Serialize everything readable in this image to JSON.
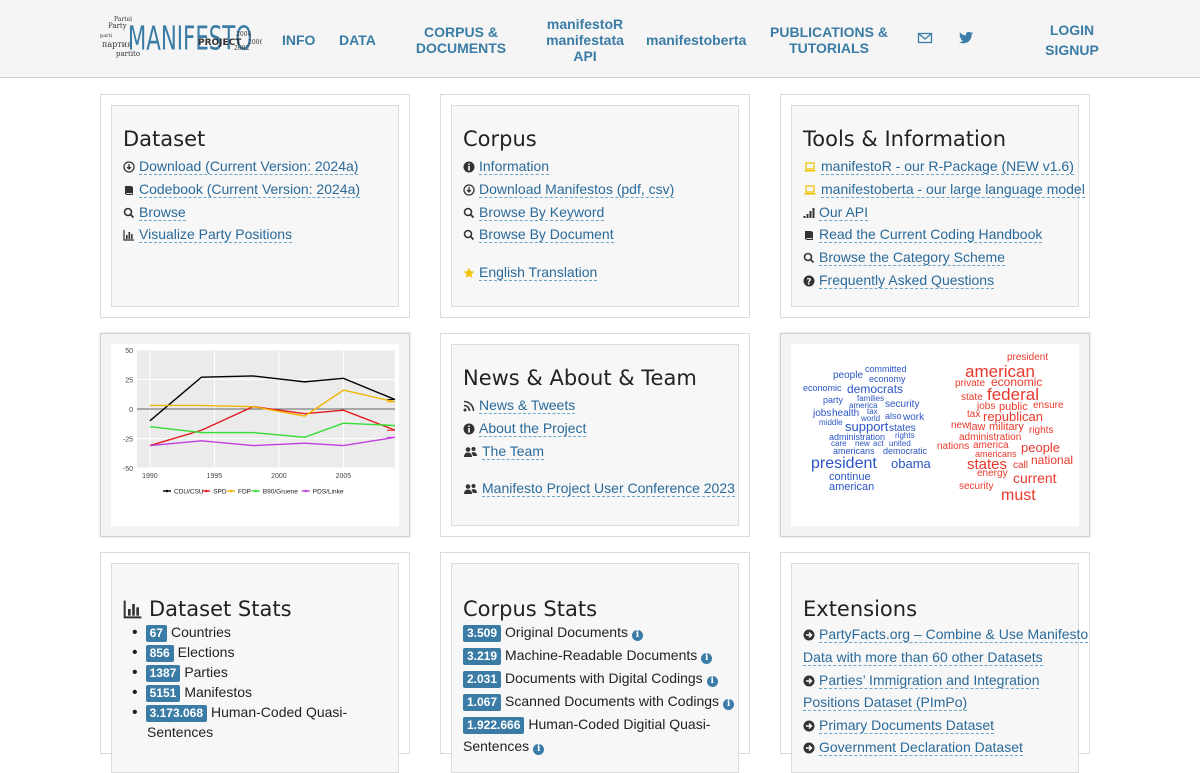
{
  "logo": {
    "main": "MANIFESTO",
    "sub": "PROJECT",
    "years": [
      "2004",
      "2002",
      "2006"
    ],
    "alt_words": [
      "Partei",
      "Party",
      "parti",
      "партия",
      "partito"
    ]
  },
  "nav": {
    "info": "INFO",
    "data": "DATA",
    "corpus": [
      "CORPUS &",
      "DOCUMENTS"
    ],
    "manifestor": [
      "manifestoR",
      "manifestata",
      "API"
    ],
    "manifestoberta": "manifestoberta",
    "publications": [
      "PUBLICATIONS &",
      "TUTORIALS"
    ],
    "login": "LOGIN",
    "signup": "SIGNUP",
    "mail_icon": "envelope-icon",
    "twitter_icon": "twitter-icon"
  },
  "dataset": {
    "title": "Dataset",
    "links": [
      {
        "icon": "download-icon",
        "label": "Download (Current Version: 2024a)"
      },
      {
        "icon": "book-icon",
        "label": "Codebook (Current Version: 2024a)"
      },
      {
        "icon": "search-icon",
        "label": "Browse"
      },
      {
        "icon": "bar-chart-icon",
        "label": "Visualize Party Positions"
      }
    ]
  },
  "corpus": {
    "title": "Corpus",
    "links": [
      {
        "icon": "info-icon",
        "label": "Information"
      },
      {
        "icon": "download-icon",
        "label": "Download Manifestos (pdf, csv)"
      },
      {
        "icon": "search-icon",
        "label": "Browse By Keyword"
      },
      {
        "icon": "search-icon",
        "label": "Browse By Document"
      },
      {
        "icon": "star-icon",
        "label": "English Translation"
      }
    ]
  },
  "tools": {
    "title": "Tools & Information",
    "links": [
      {
        "icon": "laptop-icon",
        "label": "manifestoR - our R-Package (NEW v1.6)"
      },
      {
        "icon": "laptop-icon",
        "label": "manifestoberta - our large language model"
      },
      {
        "icon": "signal-icon",
        "label": "Our API"
      },
      {
        "icon": "book-icon",
        "label": "Read the Current Coding Handbook"
      },
      {
        "icon": "search-icon",
        "label": "Browse the Category Scheme"
      },
      {
        "icon": "question-icon",
        "label": "Frequently Asked Questions"
      }
    ]
  },
  "news": {
    "title": "News & About & Team",
    "links": [
      {
        "icon": "rss-icon",
        "label": "News & Tweets"
      },
      {
        "icon": "info-icon",
        "label": "About the Project"
      },
      {
        "icon": "users-icon",
        "label": "The Team"
      },
      {
        "icon": "users-icon",
        "label": "Manifesto Project User Conference 2023"
      }
    ]
  },
  "chart_data": {
    "type": "line",
    "x": [
      1990,
      1994,
      1998,
      2002,
      2005,
      2009
    ],
    "xticks": [
      "1990",
      "1995",
      "2000",
      "2005"
    ],
    "yticks": [
      "50",
      "25",
      "0",
      "-25",
      "-50"
    ],
    "ylim": [
      -50,
      50
    ],
    "xlim": [
      1989,
      2009
    ],
    "series": [
      {
        "name": "CDU/CSU",
        "color": "#000000",
        "values": [
          -10,
          27,
          28,
          23,
          26,
          8
        ]
      },
      {
        "name": "SPD",
        "color": "#e41a1c",
        "values": [
          -31,
          -18,
          2,
          -4,
          -1,
          -18
        ]
      },
      {
        "name": "FDP",
        "color": "#f2b600",
        "values": [
          3,
          3,
          2,
          -6,
          16,
          6
        ]
      },
      {
        "name": "B90/Gruene",
        "color": "#33dd33",
        "values": [
          -15,
          -20,
          -20,
          -24,
          -12,
          -14
        ]
      },
      {
        "name": "PDS/Linke",
        "color": "#c13ee0",
        "values": [
          -31,
          -27,
          -31,
          -29,
          -31,
          -24
        ]
      }
    ],
    "grid": true,
    "legend": "bottom"
  },
  "wordcloud": {
    "blue": [
      {
        "w": "people",
        "x": 832,
        "y": 378,
        "s": 10
      },
      {
        "w": "committed",
        "x": 864,
        "y": 371,
        "s": 9
      },
      {
        "w": "economy",
        "x": 868,
        "y": 381,
        "s": 9
      },
      {
        "w": "economic",
        "x": 802,
        "y": 390,
        "s": 9
      },
      {
        "w": "democrats",
        "x": 846,
        "y": 392,
        "s": 12
      },
      {
        "w": "families",
        "x": 856,
        "y": 400,
        "s": 8
      },
      {
        "w": "party",
        "x": 822,
        "y": 402,
        "s": 9
      },
      {
        "w": "america",
        "x": 848,
        "y": 407,
        "s": 8
      },
      {
        "w": "security",
        "x": 884,
        "y": 407,
        "s": 10
      },
      {
        "w": "jobs",
        "x": 812,
        "y": 416,
        "s": 10
      },
      {
        "w": "health",
        "x": 831,
        "y": 416,
        "s": 10
      },
      {
        "w": "tax",
        "x": 866,
        "y": 413,
        "s": 8
      },
      {
        "w": "world",
        "x": 860,
        "y": 420,
        "s": 8
      },
      {
        "w": "also",
        "x": 884,
        "y": 418,
        "s": 9
      },
      {
        "w": "work",
        "x": 902,
        "y": 420,
        "s": 10
      },
      {
        "w": "middle",
        "x": 818,
        "y": 424,
        "s": 8
      },
      {
        "w": "support",
        "x": 844,
        "y": 429,
        "s": 13
      },
      {
        "w": "states",
        "x": 888,
        "y": 431,
        "s": 10
      },
      {
        "w": "administration",
        "x": 828,
        "y": 439,
        "s": 9
      },
      {
        "w": "rights",
        "x": 894,
        "y": 437,
        "s": 8
      },
      {
        "w": "care",
        "x": 830,
        "y": 445,
        "s": 8
      },
      {
        "w": "new",
        "x": 854,
        "y": 445,
        "s": 8
      },
      {
        "w": "act",
        "x": 872,
        "y": 445,
        "s": 8
      },
      {
        "w": "united",
        "x": 888,
        "y": 445,
        "s": 8
      },
      {
        "w": "americans",
        "x": 832,
        "y": 453,
        "s": 9
      },
      {
        "w": "democratic",
        "x": 882,
        "y": 453,
        "s": 9
      },
      {
        "w": "president",
        "x": 810,
        "y": 468,
        "s": 16
      },
      {
        "w": "obama",
        "x": 890,
        "y": 466,
        "s": 13
      },
      {
        "w": "continue",
        "x": 828,
        "y": 480,
        "s": 11
      },
      {
        "w": "american",
        "x": 828,
        "y": 490,
        "s": 11
      }
    ],
    "red": [
      {
        "w": "president",
        "x": 1006,
        "y": 360,
        "s": 10
      },
      {
        "w": "american",
        "x": 964,
        "y": 376,
        "s": 17
      },
      {
        "w": "private",
        "x": 954,
        "y": 386,
        "s": 10
      },
      {
        "w": "economic",
        "x": 990,
        "y": 385,
        "s": 12
      },
      {
        "w": "state",
        "x": 960,
        "y": 400,
        "s": 10
      },
      {
        "w": "federal",
        "x": 986,
        "y": 399,
        "s": 17
      },
      {
        "w": "jobs",
        "x": 976,
        "y": 409,
        "s": 10
      },
      {
        "w": "public",
        "x": 998,
        "y": 410,
        "s": 11
      },
      {
        "w": "ensure",
        "x": 1032,
        "y": 408,
        "s": 10
      },
      {
        "w": "tax",
        "x": 966,
        "y": 417,
        "s": 10
      },
      {
        "w": "republican",
        "x": 982,
        "y": 419,
        "s": 13
      },
      {
        "w": "new",
        "x": 950,
        "y": 428,
        "s": 10
      },
      {
        "w": "law",
        "x": 968,
        "y": 430,
        "s": 11
      },
      {
        "w": "military",
        "x": 988,
        "y": 430,
        "s": 11
      },
      {
        "w": "rights",
        "x": 1028,
        "y": 433,
        "s": 10
      },
      {
        "w": "administration",
        "x": 958,
        "y": 440,
        "s": 10
      },
      {
        "w": "nations",
        "x": 936,
        "y": 449,
        "s": 10
      },
      {
        "w": "america",
        "x": 972,
        "y": 448,
        "s": 10
      },
      {
        "w": "people",
        "x": 1020,
        "y": 450,
        "s": 13
      },
      {
        "w": "americans",
        "x": 974,
        "y": 456,
        "s": 9
      },
      {
        "w": "national",
        "x": 1030,
        "y": 463,
        "s": 12
      },
      {
        "w": "states",
        "x": 966,
        "y": 468,
        "s": 15
      },
      {
        "w": "call",
        "x": 1012,
        "y": 468,
        "s": 10
      },
      {
        "w": "energy",
        "x": 976,
        "y": 476,
        "s": 10
      },
      {
        "w": "current",
        "x": 1012,
        "y": 481,
        "s": 14
      },
      {
        "w": "security",
        "x": 958,
        "y": 489,
        "s": 10
      },
      {
        "w": "must",
        "x": 1000,
        "y": 500,
        "s": 16
      }
    ]
  },
  "dataset_stats": {
    "title": "Dataset Stats",
    "icon": "bar-chart-icon",
    "items": [
      {
        "value": "67",
        "label": "Countries"
      },
      {
        "value": "856",
        "label": "Elections"
      },
      {
        "value": "1387",
        "label": "Parties"
      },
      {
        "value": "5151",
        "label": "Manifestos"
      },
      {
        "value": "3.173.068",
        "label": "Human-Coded Quasi-",
        "label2": "Sentences"
      }
    ]
  },
  "corpus_stats": {
    "title": "Corpus Stats",
    "items": [
      {
        "value": "3.509",
        "label": "Original Documents"
      },
      {
        "value": "3.219",
        "label": "Machine-Readable Documents"
      },
      {
        "value": "2.031",
        "label": "Documents with Digital Codings"
      },
      {
        "value": "1.067",
        "label": "Scanned Documents with Codings"
      },
      {
        "value": "1.922.666",
        "label": "Human-Coded Digitial Quasi-",
        "label2": "Sentences"
      }
    ],
    "info_glyph": "i"
  },
  "extensions": {
    "title": "Extensions",
    "links": [
      {
        "label": "PartyFacts.org – Combine & Use Manifesto",
        "label2": "Data with more than 60 other Datasets"
      },
      {
        "label": "Parties’ Immigration and Integration",
        "label2": "Positions Dataset (PImPo)"
      },
      {
        "label": "Primary Documents Dataset"
      },
      {
        "label": "Government Declaration Dataset"
      }
    ]
  }
}
